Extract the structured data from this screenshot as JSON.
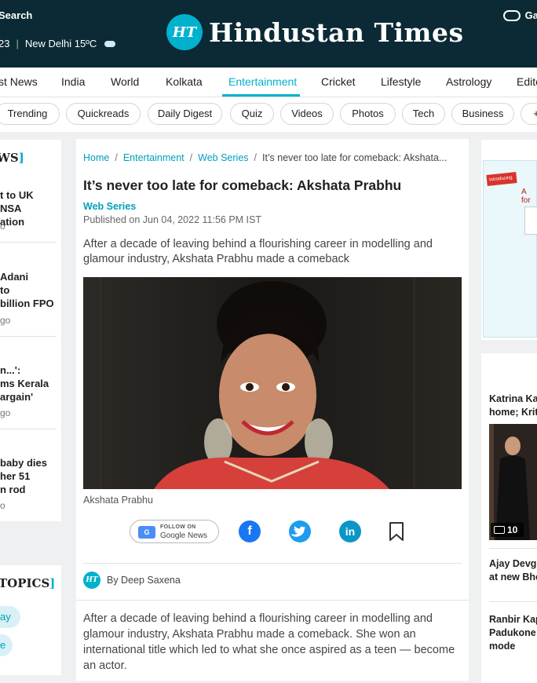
{
  "header": {
    "search_label": "Search",
    "date_fragment": "23",
    "weather": "New Delhi 15ºC",
    "logo_badge": "HT",
    "logo_text": "Hindustan Times",
    "games_label": "Ga"
  },
  "nav": {
    "items": [
      "st News",
      "India",
      "World",
      "Kolkata",
      "Entertainment",
      "Cricket",
      "Lifestyle",
      "Astrology",
      "Edito"
    ],
    "active": "Entertainment"
  },
  "pills": [
    "Trending",
    "Quickreads",
    "Daily Digest",
    "Quiz",
    "Videos",
    "Photos",
    "Tech",
    "Business",
    "+"
  ],
  "left": {
    "news_heading": "WS",
    "news": [
      {
        "title_lines": [
          "t to UK NSA",
          "ation"
        ],
        "meta": "o"
      },
      {
        "title_lines": [
          "Adani",
          "to",
          "billion FPO"
        ],
        "meta": "go"
      },
      {
        "title_lines": [
          "n...':",
          "ms Kerala",
          "argain'"
        ],
        "meta": "go"
      },
      {
        "title_lines": [
          "baby dies",
          "her 51",
          "n rod"
        ],
        "meta": "o"
      }
    ],
    "topics_heading": "TOPICS",
    "topics": [
      "ay",
      "e"
    ]
  },
  "article": {
    "breadcrumb": [
      "Home",
      "Entertainment",
      "Web Series",
      "It’s never too late for comeback: Akshata..."
    ],
    "headline": "It’s never too late for comeback: Akshata Prabhu",
    "section": "Web Series",
    "published": "Published on Jun 04, 2022 11:56 PM IST",
    "summary": "After a decade of leaving behind a flourishing career in modelling and glamour industry, Akshata Prabhu made a comeback",
    "caption": "Akshata Prabhu",
    "follow_on": "FOLLOW ON",
    "google_news": "Google News",
    "author_badge": "HT",
    "author": "By Deep Saxena",
    "body": "After a decade of leaving behind a flourishing career in modelling and glamour industry, Akshata Prabhu made a comeback. She won an international title which led to what she once aspired as a teen — become an actor."
  },
  "right": {
    "ad_badge": "Introducing",
    "ad_title": "A",
    "ad_title2": "for",
    "items": [
      {
        "title_lines": [
          "Katrina Ka",
          "home; Krit"
        ]
      },
      {
        "title_lines": [
          "Ajay Devgn",
          "at new Bho"
        ]
      },
      {
        "title_lines": [
          "Ranbir Kap",
          "Padukone g",
          "mode"
        ]
      }
    ],
    "photo_count": "10"
  },
  "colors": {
    "header_bg": "#0b2a35",
    "accent": "#00b1cd",
    "facebook": "#1877f2",
    "twitter": "#1d9bf0",
    "linkedin": "#0a95c7"
  }
}
